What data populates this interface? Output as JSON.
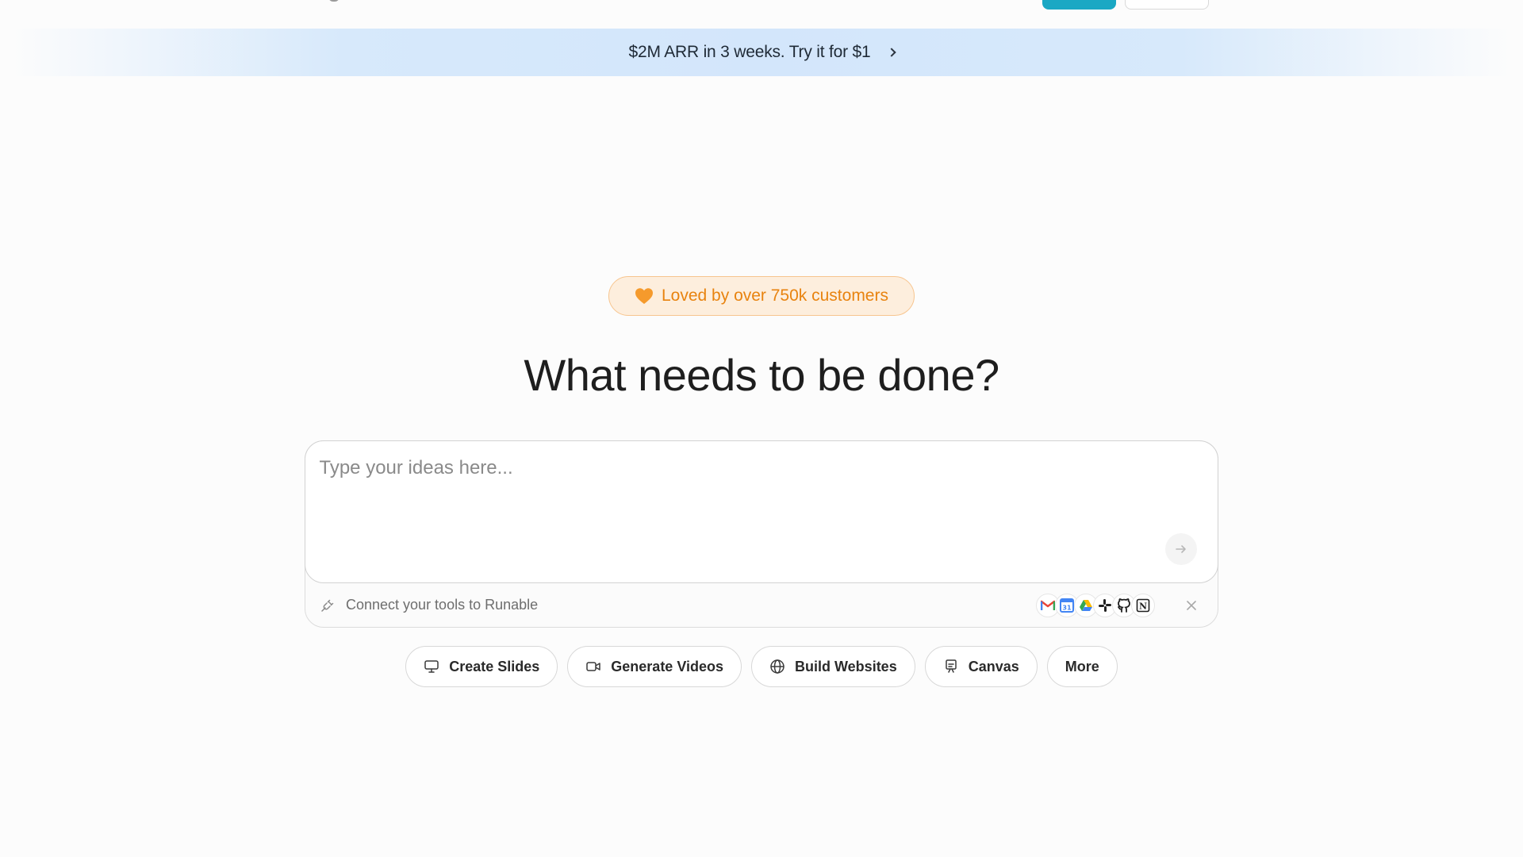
{
  "banner": {
    "text": "$2M ARR in 3 weeks. Try it for $1",
    "icon": "chevron-right-icon"
  },
  "badge": {
    "text": "Loved by over 750k customers",
    "icon": "heart-icon",
    "color": "#e8830f"
  },
  "headline": "What needs to be done?",
  "composer": {
    "placeholder": "Type your ideas here...",
    "value": "",
    "connect_text": "Connect your tools to Runable",
    "tools": [
      "gmail-icon",
      "google-calendar-icon",
      "google-drive-icon",
      "slack-icon",
      "github-icon",
      "notion-icon"
    ],
    "calendar_day": "31",
    "notion_letter": "N"
  },
  "actions": [
    {
      "label": "Create Slides",
      "icon": "presentation-icon"
    },
    {
      "label": "Generate Videos",
      "icon": "video-camera-icon"
    },
    {
      "label": "Build Websites",
      "icon": "globe-icon"
    },
    {
      "label": "Canvas",
      "icon": "easel-icon"
    },
    {
      "label": "More"
    }
  ],
  "colors": {
    "accent": "#1aa8c4",
    "banner_bg": "#d5e8fb",
    "badge_bg": "#fdeedd"
  }
}
